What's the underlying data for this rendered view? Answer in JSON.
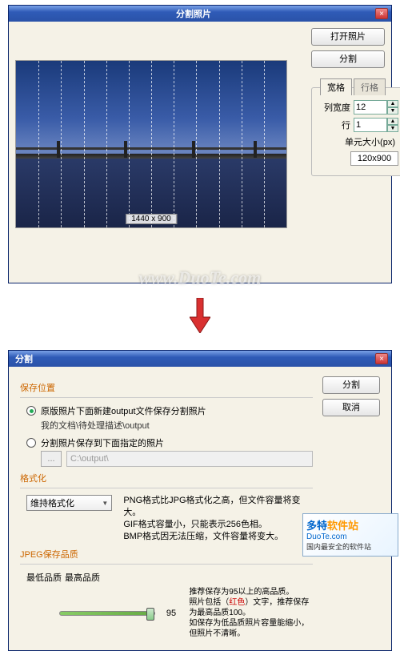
{
  "window1": {
    "title": "分割照片",
    "close": "×",
    "open_photo_btn": "打开照片",
    "split_btn": "分割",
    "tabs": {
      "wide": "宽格",
      "row": "行格"
    },
    "col_width_label": "列宽度",
    "col_width_value": "12",
    "row_label": "行",
    "row_value": "1",
    "cell_size_label": "单元大小(px)",
    "cell_size_value": "120x900",
    "image_dims": "1440 x 900",
    "grid_columns": 12
  },
  "watermark": "www.DuoTe.com",
  "window2": {
    "title": "分割",
    "close": "×",
    "split_btn": "分割",
    "cancel_btn": "取消",
    "group_save": "保存位置",
    "radio1_label": "原版照片下面新建output文件保存分割照片",
    "radio1_path": "我的文档\\待处理描述\\output",
    "radio2_label": "分割照片保存到下面指定的照片",
    "browse_btn": "...",
    "browse_path": "C:\\output\\",
    "group_fmt": "格式化",
    "fmt_select": "维持格式化",
    "fmt_desc_1": "PNG格式比JPG格式化之高，但文件容量将变大。",
    "fmt_desc_2": "GIF格式容量小，只能表示256色相。",
    "fmt_desc_3": "BMP格式因无法压缩，文件容量将变大。",
    "group_jpeg": "JPEG保存品质",
    "q_low": "最低品质",
    "q_high": "最高品质",
    "q_value": "95",
    "q_desc_1": "推荐保存为95以上的高品质。",
    "q_desc_2": "照片包括（红色）文字，推荐保存为最高品质100。",
    "q_desc_3": "如保存为低品质照片容量能缩小，但照片不清晰。"
  },
  "footer": {
    "brand_a": "多特",
    "brand_b": "软件站",
    "domain": "DuoTe.com",
    "tag": "国内最安全的软件站"
  }
}
